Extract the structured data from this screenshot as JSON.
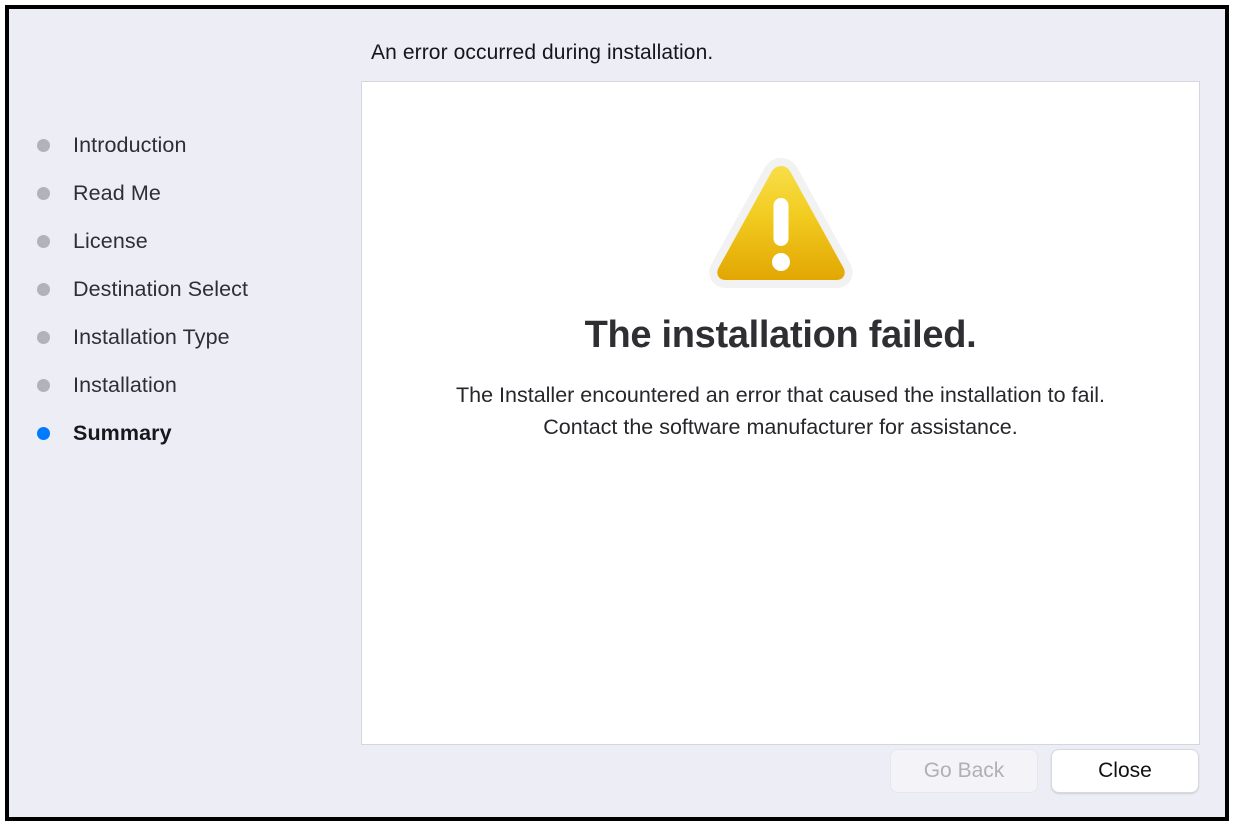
{
  "window": {
    "header_title": "An error occurred during installation."
  },
  "sidebar": {
    "items": [
      {
        "label": "Introduction",
        "state": "done"
      },
      {
        "label": "Read Me",
        "state": "done"
      },
      {
        "label": "License",
        "state": "done"
      },
      {
        "label": "Destination Select",
        "state": "done"
      },
      {
        "label": "Installation Type",
        "state": "done"
      },
      {
        "label": "Installation",
        "state": "done"
      },
      {
        "label": "Summary",
        "state": "active"
      }
    ],
    "dot_color_done": "#B2B2B8",
    "dot_color_active": "#007AFF"
  },
  "panel": {
    "icon": "warning-triangle-icon",
    "icon_colors": {
      "top": "#F7DC42",
      "bottom": "#E3A600",
      "stroke": "#F1F1F1",
      "glyph": "#FFFFFF"
    },
    "title": "The installation failed.",
    "body": "The Installer encountered an error that caused the installation to fail. Contact the software manufacturer for assistance."
  },
  "buttons": {
    "go_back": {
      "label": "Go Back",
      "enabled": false
    },
    "close": {
      "label": "Close",
      "enabled": true
    }
  }
}
